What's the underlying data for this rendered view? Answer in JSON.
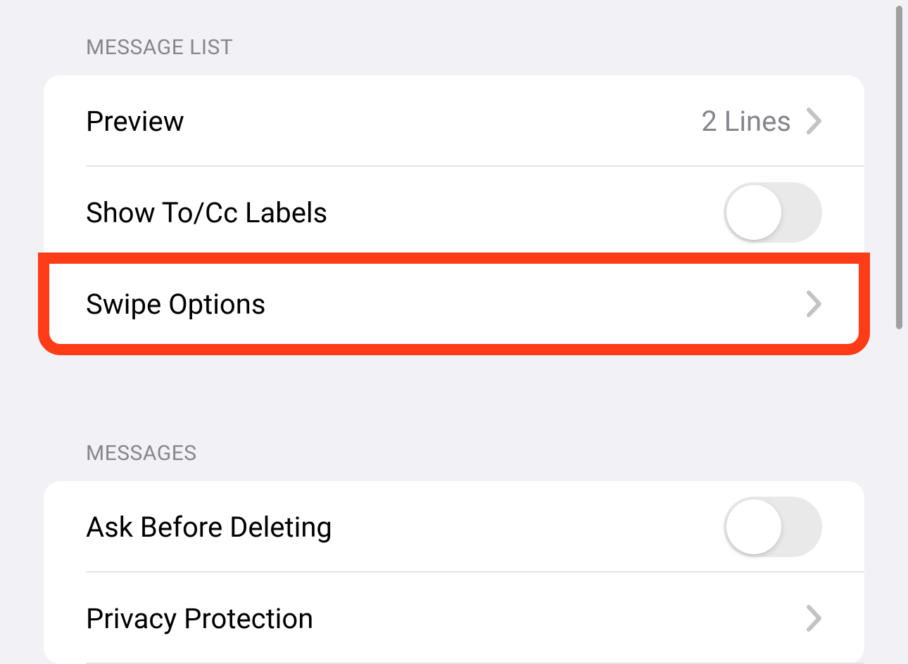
{
  "sections": {
    "message_list": {
      "header": "Message List",
      "rows": {
        "preview": {
          "label": "Preview",
          "value": "2 Lines"
        },
        "show_tocc": {
          "label": "Show To/Cc Labels",
          "toggle_on": false
        },
        "swipe_options": {
          "label": "Swipe Options"
        }
      }
    },
    "messages": {
      "header": "Messages",
      "rows": {
        "ask_before_deleting": {
          "label": "Ask Before Deleting",
          "toggle_on": false
        },
        "privacy_protection": {
          "label": "Privacy Protection"
        }
      }
    }
  }
}
